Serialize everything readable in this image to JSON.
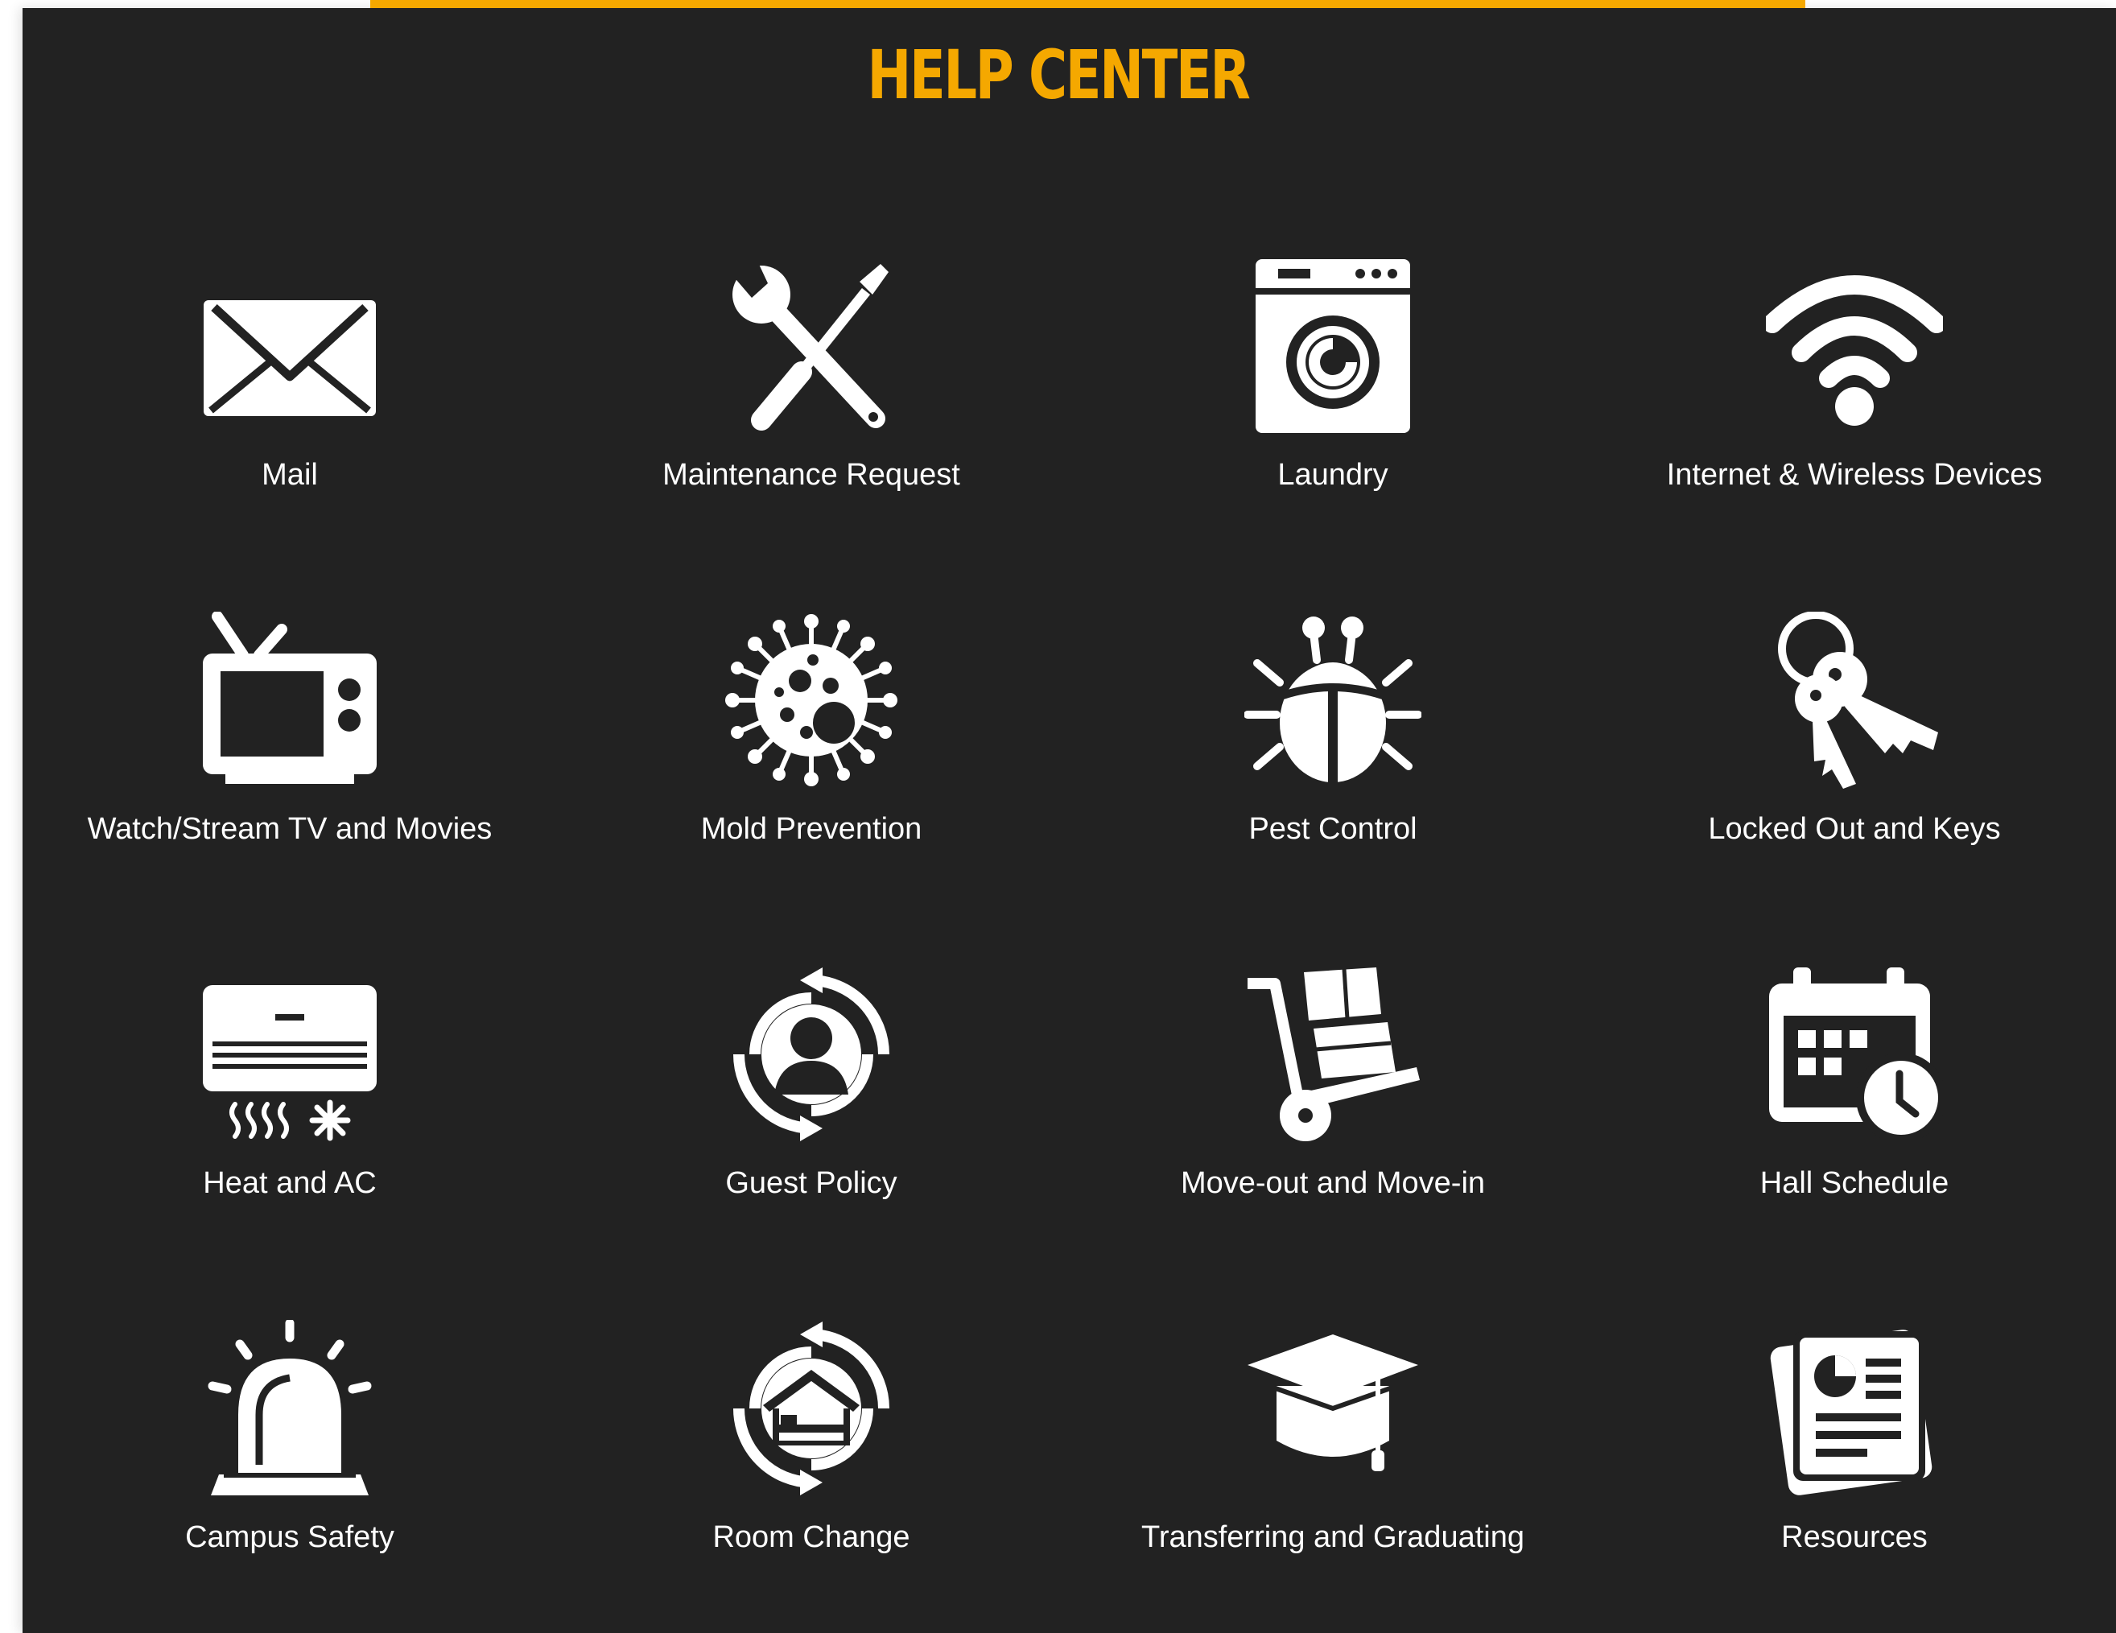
{
  "header": {
    "title": "HELP CENTER"
  },
  "colors": {
    "background": "#222222",
    "accent": "#F5A800",
    "icon": "#ffffff",
    "label": "#ffffff"
  },
  "items": [
    {
      "label": "Mail",
      "icon": "mail-icon"
    },
    {
      "label": "Maintenance Request",
      "icon": "tools-icon"
    },
    {
      "label": "Laundry",
      "icon": "washing-machine-icon"
    },
    {
      "label": "Internet & Wireless Devices",
      "icon": "wifi-icon"
    },
    {
      "label": "Watch/Stream TV and Movies",
      "icon": "tv-icon"
    },
    {
      "label": "Mold Prevention",
      "icon": "mold-icon"
    },
    {
      "label": "Pest Control",
      "icon": "bug-icon"
    },
    {
      "label": "Locked Out and Keys",
      "icon": "keys-icon"
    },
    {
      "label": "Heat and AC",
      "icon": "air-conditioner-icon"
    },
    {
      "label": "Guest Policy",
      "icon": "guest-icon"
    },
    {
      "label": "Move-out and Move-in",
      "icon": "hand-truck-icon"
    },
    {
      "label": "Hall Schedule",
      "icon": "calendar-clock-icon"
    },
    {
      "label": "Campus Safety",
      "icon": "siren-icon"
    },
    {
      "label": "Room Change",
      "icon": "room-change-icon"
    },
    {
      "label": "Transferring and Graduating",
      "icon": "graduation-cap-icon"
    },
    {
      "label": "Resources",
      "icon": "documents-icon"
    }
  ]
}
